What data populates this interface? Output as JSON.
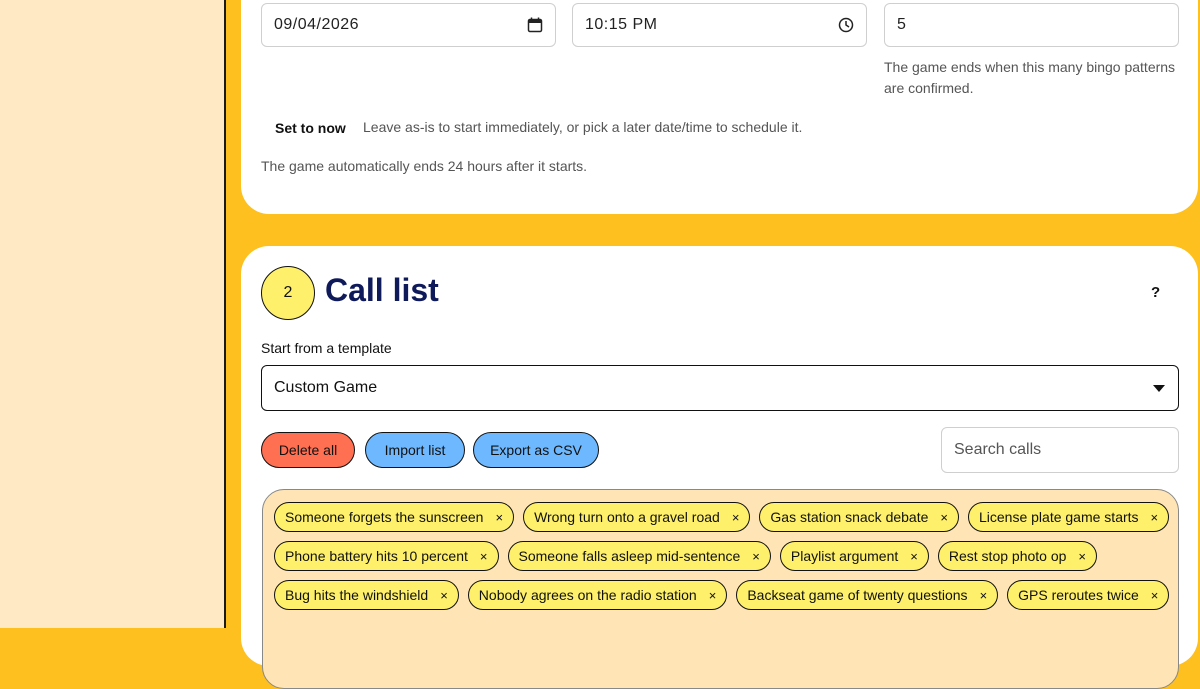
{
  "schedule": {
    "date_value": "09/04/2026",
    "time_value": "10:15 PM",
    "patterns_value": "5",
    "patterns_helper": "The game ends when this many bingo patterns are confirmed.",
    "set_now_label": "Set to now",
    "set_now_helper": "Leave as-is to start immediately, or pick a later date/time to schedule it.",
    "auto_end_note": "The game automatically ends 24 hours after it starts."
  },
  "call_list": {
    "step_number": "2",
    "title": "Call list",
    "help_label": "?",
    "template_label": "Start from a template",
    "template_value": "Custom Game",
    "delete_all_label": "Delete all",
    "import_label": "Import list",
    "export_label": "Export as CSV",
    "search_placeholder": "Search calls",
    "chips": [
      "Someone forgets the sunscreen",
      "Wrong turn onto a gravel road",
      "Gas station snack debate",
      "License plate game starts",
      "Phone battery hits 10 percent",
      "Someone falls asleep mid-sentence",
      "Playlist argument",
      "Rest stop photo op",
      "Bug hits the windshield",
      "Nobody agrees on the radio station",
      "Backseat game of twenty questions",
      "GPS reroutes twice"
    ],
    "remove_glyph": "×"
  },
  "colors": {
    "page_bg": "#FEC01E",
    "left_pane": "#FFE9C4",
    "delete_btn": "#FF6F52",
    "action_btn": "#6DB8FF",
    "chip": "#FEF06A",
    "step_circle": "#FEF06A",
    "title": "#0f1a5a"
  }
}
